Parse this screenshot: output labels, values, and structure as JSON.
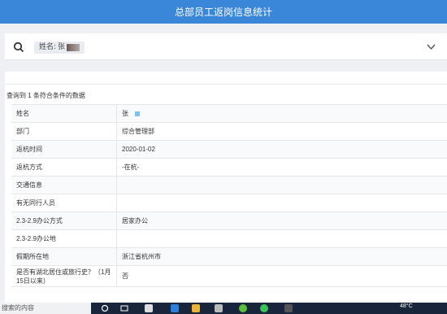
{
  "header": {
    "title": "总部员工返岗信息统计"
  },
  "search": {
    "chip_label": "姓名:",
    "chip_value": "张"
  },
  "result_text": "查询到 1 条符合条件的数据",
  "rows": [
    {
      "label": "姓名",
      "value": "张"
    },
    {
      "label": "部门",
      "value": "综合管理部"
    },
    {
      "label": "返杭时间",
      "value": "2020-01-02"
    },
    {
      "label": "返杭方式",
      "value": "-在杭-"
    },
    {
      "label": "交通信息",
      "value": ""
    },
    {
      "label": "有无同行人员",
      "value": ""
    },
    {
      "label": "2.3-2.9办公方式",
      "value": "居家办公"
    },
    {
      "label": "2.3-2.9办公地",
      "value": ""
    },
    {
      "label": "假期所在地",
      "value": "浙江省杭州市"
    },
    {
      "label": "是否有湖北居住或旅行史？（1月15日以来）",
      "value": "否"
    }
  ],
  "taskbar": {
    "search_text": "搜索的内容",
    "temperature": "48°C"
  },
  "colors": {
    "header_bg": "#3a86d8",
    "taskbar_bg": "#18253a",
    "page_bg": "#eef0f3"
  },
  "icons": [
    "search-icon",
    "chevron-down-icon",
    "windows-start-icon",
    "task-view-icon",
    "browser-icon",
    "folder-icon",
    "wechat-icon"
  ]
}
